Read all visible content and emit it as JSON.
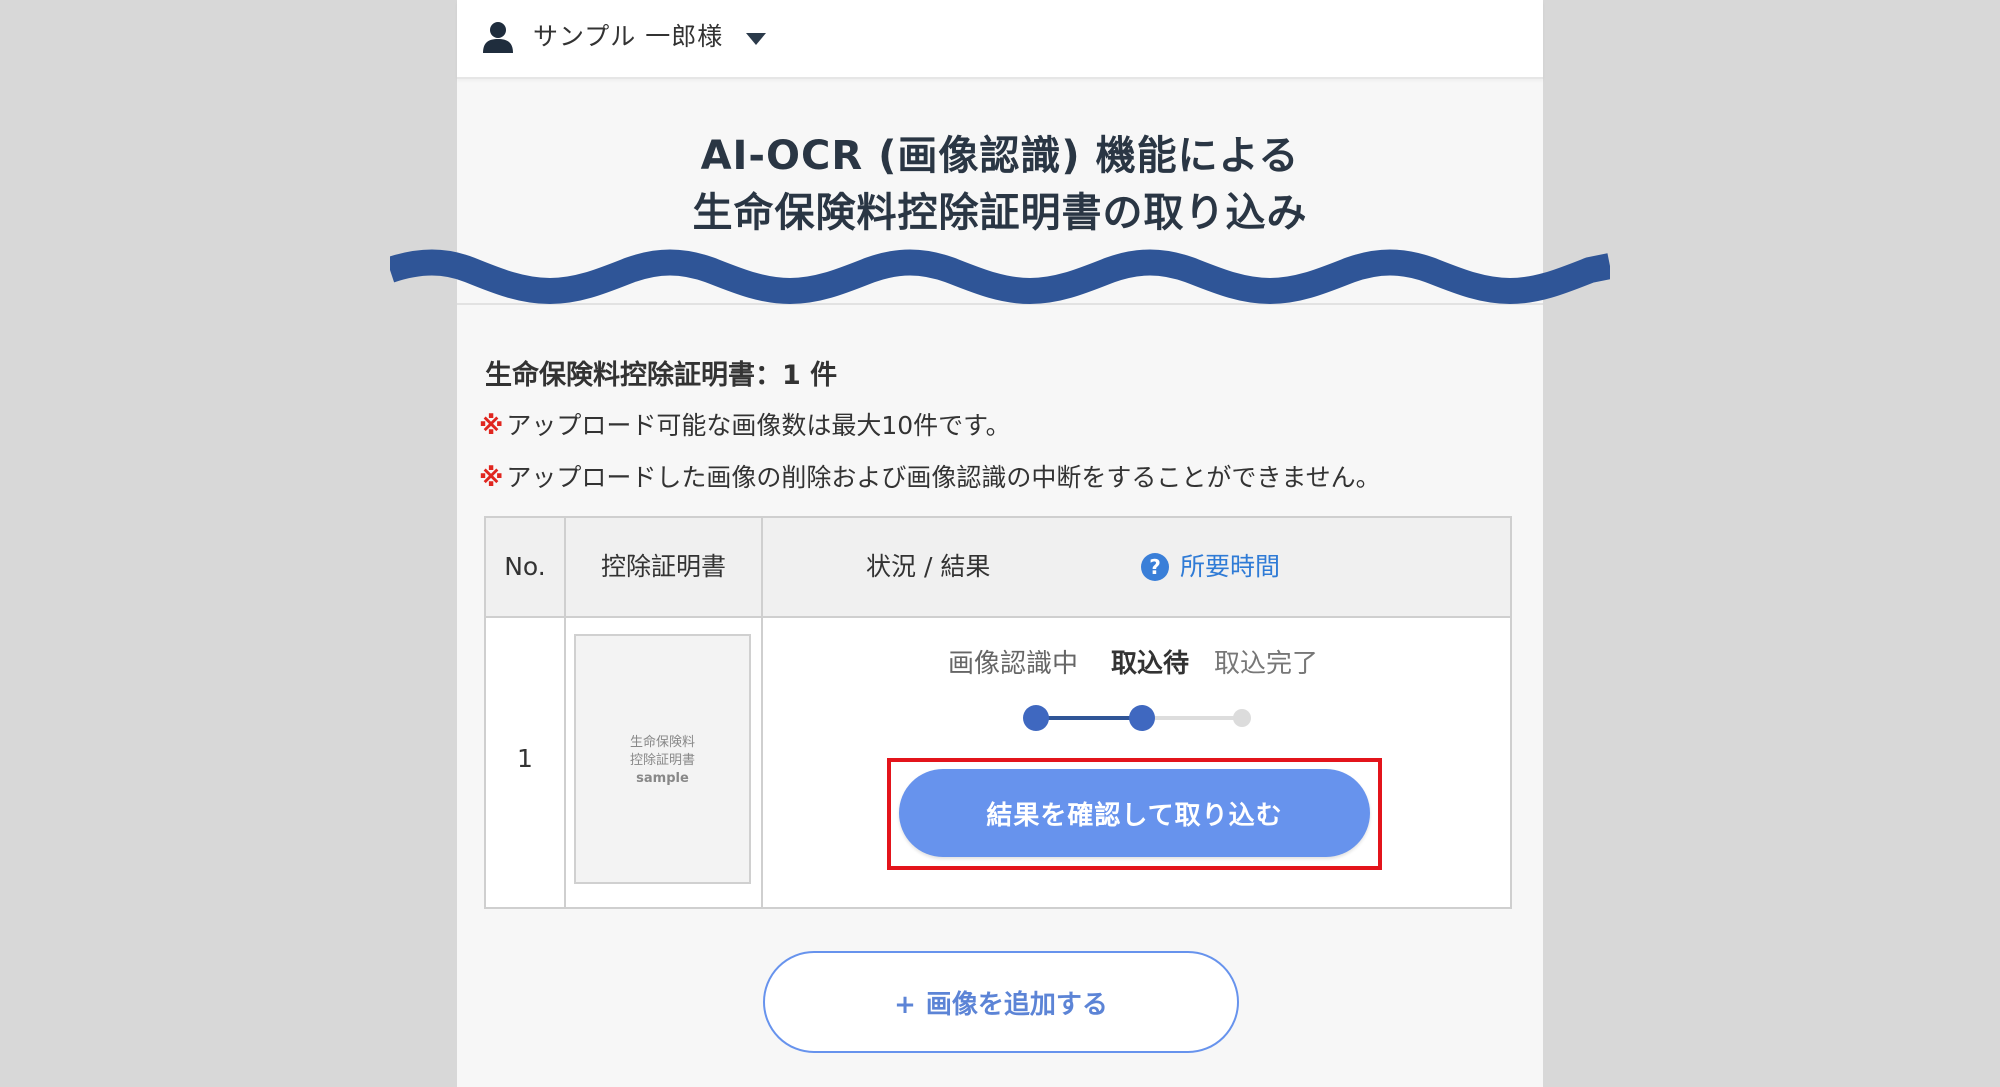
{
  "header": {
    "user_name": "サンプル 一郎様"
  },
  "title": {
    "line1": "AI-OCR (画像認識) 機能による",
    "line2": "生命保険料控除証明書の取り込み"
  },
  "summary": {
    "count_label": "生命保険料控除証明書：1 件"
  },
  "notes": {
    "mark": "※",
    "note1": "アップロード可能な画像数は最大10件です。",
    "note2": "アップロードした画像の削除および画像認識の中断をすることができません。"
  },
  "table": {
    "headers": {
      "no": "No.",
      "certificate": "控除証明書",
      "status": "状況 / 結果",
      "time_link": "所要時間"
    },
    "rows": [
      {
        "no": "1",
        "thumbnail": {
          "line1": "生命保険料",
          "line2": "控除証明書",
          "line3": "sample"
        },
        "steps": [
          "画像認識中",
          "取込待",
          "取込完了"
        ],
        "current_step": 2,
        "action_label": "結果を確認して取り込む"
      }
    ]
  },
  "add_button": {
    "plus": "+",
    "label": "画像を追加する"
  },
  "colors": {
    "accent": "#6793ed",
    "highlight": "#e3141b",
    "wave": "#2f5597",
    "note_mark": "#e0261f"
  }
}
